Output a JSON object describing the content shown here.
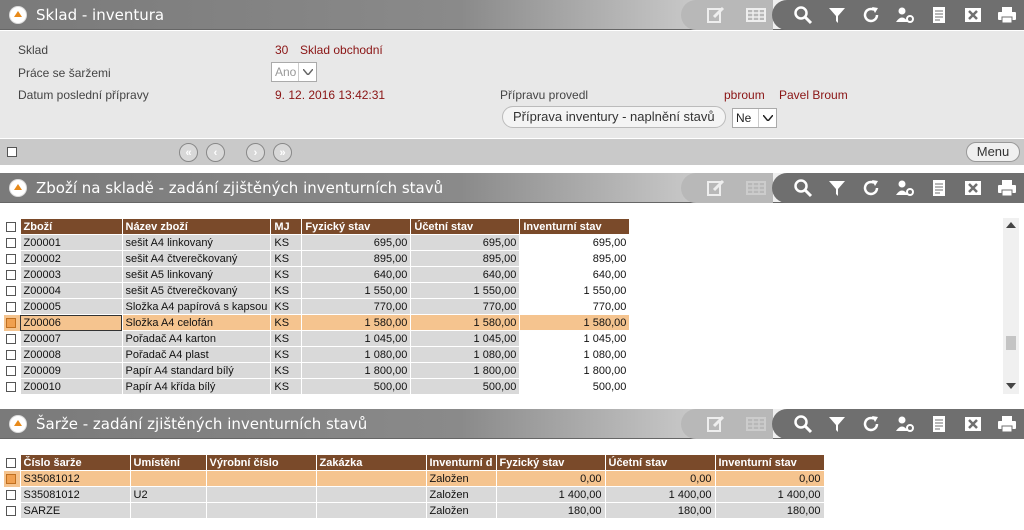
{
  "header1": {
    "title": "Sklad - inventura"
  },
  "header2": {
    "title": "Zboží na skladě - zadání zjištěných inventurních stavů"
  },
  "header3": {
    "title": "Šarže - zadání zjištěných inventurních stavů"
  },
  "info": {
    "sklad_label": "Sklad",
    "sklad_code": "30",
    "sklad_name": "Sklad obchodní",
    "sarze_label": "Práce se šaržemi",
    "sarze_value": "Ano",
    "datum_label": "Datum poslední přípravy",
    "datum_value": "9. 12. 2016 13:42:31",
    "provedl_label": "Přípravu provedl",
    "provedl_login": "pbroum",
    "provedl_name": "Pavel Broum",
    "priprava_button": "Příprava inventury - naplnění stavů",
    "priprava_select": "Ne"
  },
  "nav": {
    "menu_label": "Menu",
    "first": "«",
    "prev": "‹",
    "next": "›",
    "last": "»"
  },
  "goods_table": {
    "columns": [
      "Zboží",
      "Název zboží",
      "MJ",
      "Fyzický stav",
      "Účetní stav",
      "Inventurní stav"
    ],
    "rows": [
      [
        "Z00001",
        "sešit A4 linkovaný",
        "KS",
        "695,00",
        "695,00",
        "695,00"
      ],
      [
        "Z00002",
        "sešit A4 čtverečkovaný",
        "KS",
        "895,00",
        "895,00",
        "895,00"
      ],
      [
        "Z00003",
        "sešit A5 linkovaný",
        "KS",
        "640,00",
        "640,00",
        "640,00"
      ],
      [
        "Z00004",
        "sešit A5 čtverečkovaný",
        "KS",
        "1 550,00",
        "1 550,00",
        "1 550,00"
      ],
      [
        "Z00005",
        "Složka A4 papírová s kapsou",
        "KS",
        "770,00",
        "770,00",
        "770,00"
      ],
      [
        "Z00006",
        "Složka A4 celofán",
        "KS",
        "1 580,00",
        "1 580,00",
        "1 580,00"
      ],
      [
        "Z00007",
        "Pořadač A4 karton",
        "KS",
        "1 045,00",
        "1 045,00",
        "1 045,00"
      ],
      [
        "Z00008",
        "Pořadač A4 plast",
        "KS",
        "1 080,00",
        "1 080,00",
        "1 080,00"
      ],
      [
        "Z00009",
        "Papír A4 standard bílý",
        "KS",
        "1 800,00",
        "1 800,00",
        "1 800,00"
      ],
      [
        "Z00010",
        "Papír A4 křída bílý",
        "KS",
        "500,00",
        "500,00",
        "500,00"
      ]
    ],
    "selected_row": 5
  },
  "batch_table": {
    "columns": [
      "Číslo šarže",
      "Umístění",
      "Výrobní číslo",
      "Zakázka",
      "Inventurní d",
      "Fyzický stav",
      "Účetní stav",
      "Inventurní stav"
    ],
    "rows": [
      [
        "S35081012",
        "",
        "",
        "",
        "Založen",
        "0,00",
        "0,00",
        "0,00"
      ],
      [
        "S35081012",
        "U2",
        "",
        "",
        "Založen",
        "1 400,00",
        "1 400,00",
        "1 400,00"
      ],
      [
        "SARZE",
        "",
        "",
        "",
        "Založen",
        "180,00",
        "180,00",
        "180,00"
      ]
    ],
    "selected_row": 0
  },
  "colors": {
    "accent": "#8a1414",
    "table_header": "#7a4a2a",
    "selection": "#f5c48f",
    "orange_icon": "#e88a1a"
  }
}
